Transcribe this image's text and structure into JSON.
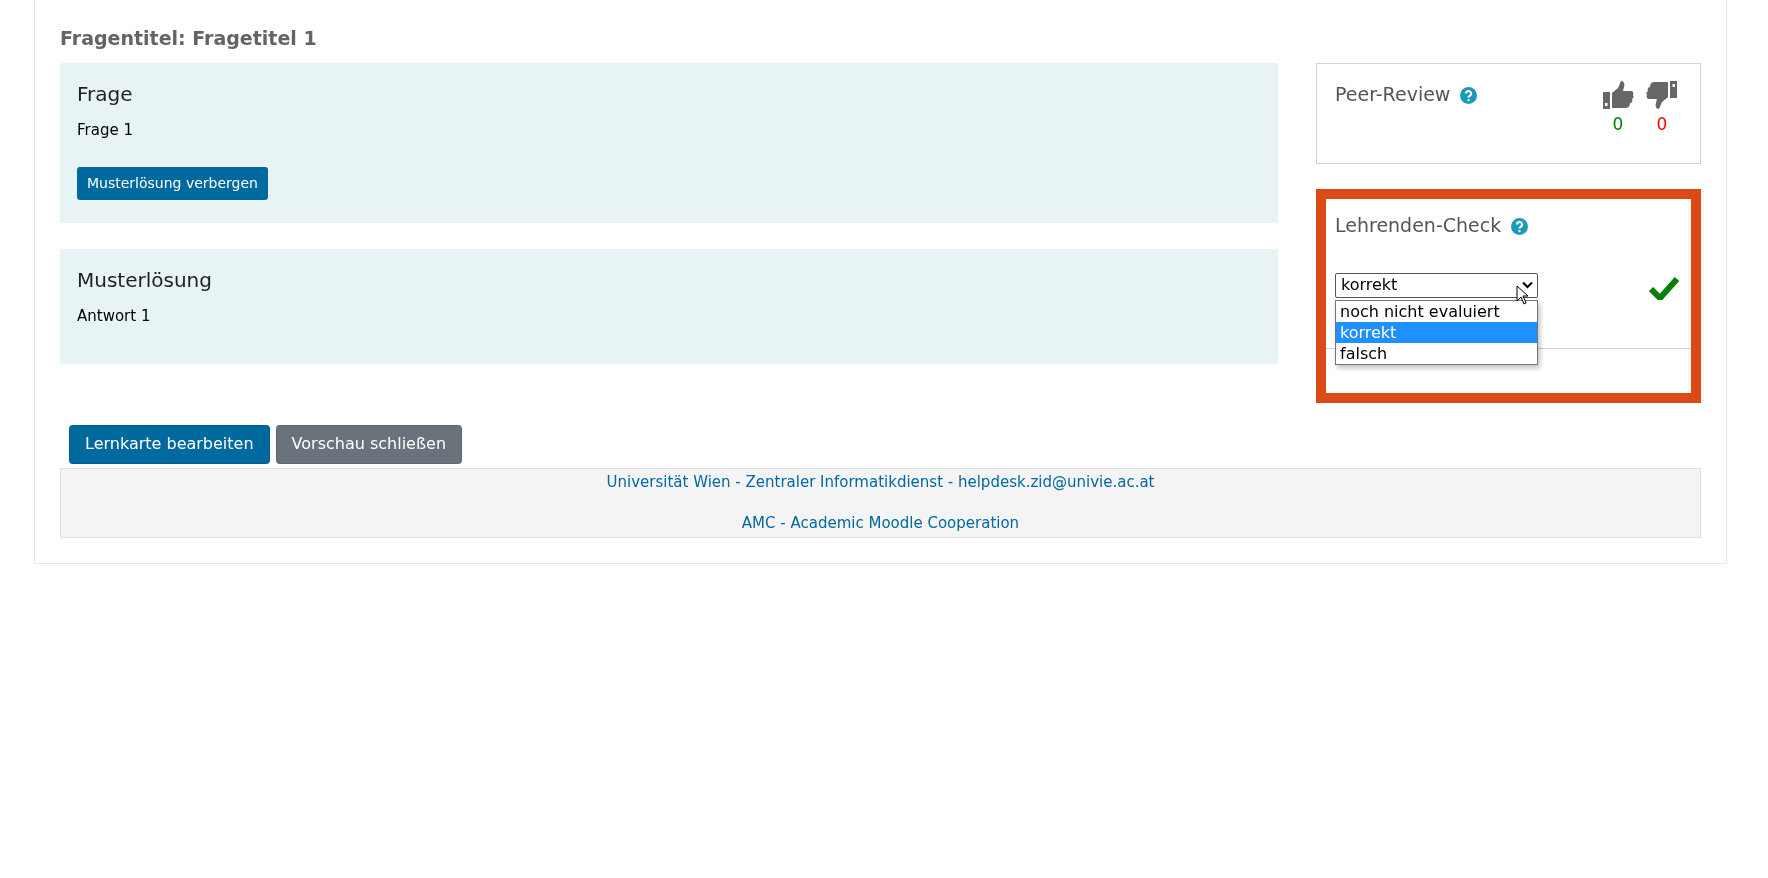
{
  "page_title": "Fragentitel: Fragetitel 1",
  "sections": [
    {
      "heading": "Frage",
      "text": "Frage 1",
      "button": "Musterlösung verbergen"
    },
    {
      "heading": "Musterlösung",
      "text": "Antwort 1"
    }
  ],
  "peer_review": {
    "title": "Peer-Review",
    "likes": "0",
    "dislikes": "0"
  },
  "teacher_check": {
    "title": "Lehrenden-Check",
    "highlighted": true,
    "correct": true,
    "select": {
      "value": "korrekt",
      "expanded": true,
      "options": [
        {
          "label": "noch nicht evaluiert",
          "selected": false
        },
        {
          "label": "korrekt",
          "selected": true
        },
        {
          "label": "falsch",
          "selected": false
        }
      ]
    }
  },
  "actions": [
    {
      "label": "Lernkarte bearbeiten",
      "kind": "primary"
    },
    {
      "label": "Vorschau schließen",
      "kind": "secondary"
    }
  ],
  "footer": {
    "links": [
      "Universität Wien - Zentraler Informatikdienst - helpdesk.zid@univie.ac.at",
      "AMC - Academic Moodle Cooperation"
    ]
  }
}
